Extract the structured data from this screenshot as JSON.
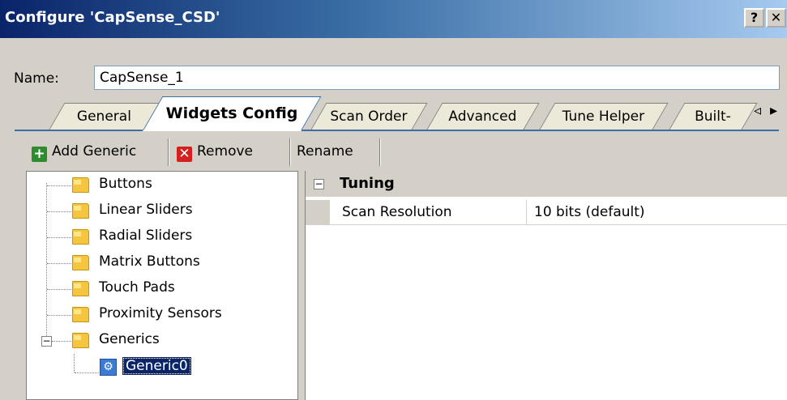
{
  "window": {
    "title": "Configure 'CapSense_CSD'",
    "help_label": "?",
    "close_label": "✕"
  },
  "name_field": {
    "label": "Name:",
    "value": "CapSense_1"
  },
  "tabs": [
    {
      "label": "General",
      "active": false
    },
    {
      "label": "Widgets Config",
      "active": true
    },
    {
      "label": "Scan Order",
      "active": false
    },
    {
      "label": "Advanced",
      "active": false
    },
    {
      "label": "Tune Helper",
      "active": false
    },
    {
      "label": "Built-",
      "active": false
    }
  ],
  "tab_scroll": {
    "left": "◃",
    "right": "▸"
  },
  "toolbar": {
    "add_label": "Add Generic",
    "remove_label": "Remove",
    "rename_label": "Rename"
  },
  "tree": {
    "items": [
      {
        "label": "Buttons",
        "icon": "folder-icon"
      },
      {
        "label": "Linear Sliders",
        "icon": "folder-icon"
      },
      {
        "label": "Radial Sliders",
        "icon": "folder-icon"
      },
      {
        "label": "Matrix Buttons",
        "icon": "folder-icon"
      },
      {
        "label": "Touch Pads",
        "icon": "folder-icon"
      },
      {
        "label": "Proximity Sensors",
        "icon": "folder-icon"
      },
      {
        "label": "Generics",
        "icon": "folder-icon",
        "expanded": true,
        "expander": "−"
      }
    ],
    "child": {
      "label": "Generic0",
      "icon": "gear-icon",
      "selected": true
    }
  },
  "properties": {
    "category": {
      "expander": "−",
      "label": "Tuning"
    },
    "rows": [
      {
        "name": "Scan Resolution",
        "value": "10 bits (default)"
      }
    ]
  },
  "colors": {
    "title_gradient_start": "#0a246a",
    "title_gradient_end": "#a6caf0",
    "selection": "#0a246a",
    "add_icon": "#2e8b2e",
    "remove_icon": "#d42020"
  }
}
